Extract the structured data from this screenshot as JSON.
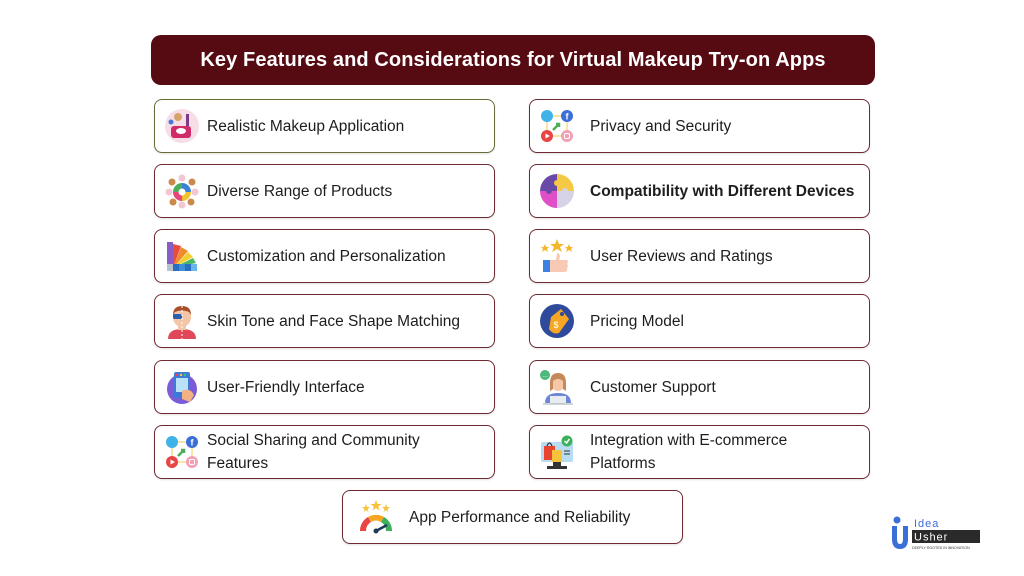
{
  "title": "Key Features and Considerations for Virtual Makeup Try-on Apps",
  "left_features": [
    {
      "label": "Realistic Makeup Application",
      "icon": "makeup-kit-icon"
    },
    {
      "label": "Diverse Range of Products",
      "icon": "product-range-icon"
    },
    {
      "label": "Customization and Personalization",
      "icon": "color-palette-icon"
    },
    {
      "label": "Skin Tone and Face Shape Matching",
      "icon": "face-match-icon"
    },
    {
      "label": "User-Friendly Interface",
      "icon": "touch-screen-icon"
    },
    {
      "label": "Social Sharing and Community Features",
      "icon": "social-media-icon"
    }
  ],
  "right_features": [
    {
      "label": "Privacy and Security",
      "icon": "social-media-icon"
    },
    {
      "label": "Compatibility with Different Devices",
      "icon": "puzzle-icon"
    },
    {
      "label": "User Reviews and Ratings",
      "icon": "thumbs-up-stars-icon"
    },
    {
      "label": "Pricing Model",
      "icon": "price-tag-icon"
    },
    {
      "label": "Customer Support",
      "icon": "support-agent-icon"
    },
    {
      "label": "Integration with E-commerce Platforms",
      "icon": "ecommerce-icon"
    }
  ],
  "bottom_feature": {
    "label": "App Performance and Reliability",
    "icon": "speedometer-icon"
  },
  "logo": {
    "line1": "Idea",
    "line2": "Usher",
    "tagline": "DEEPLY ROOTED IN INNOVATION"
  },
  "colors": {
    "title_bg": "#560a12",
    "card_border": "#6e2a32",
    "logo_blue": "#3b6fd8"
  }
}
